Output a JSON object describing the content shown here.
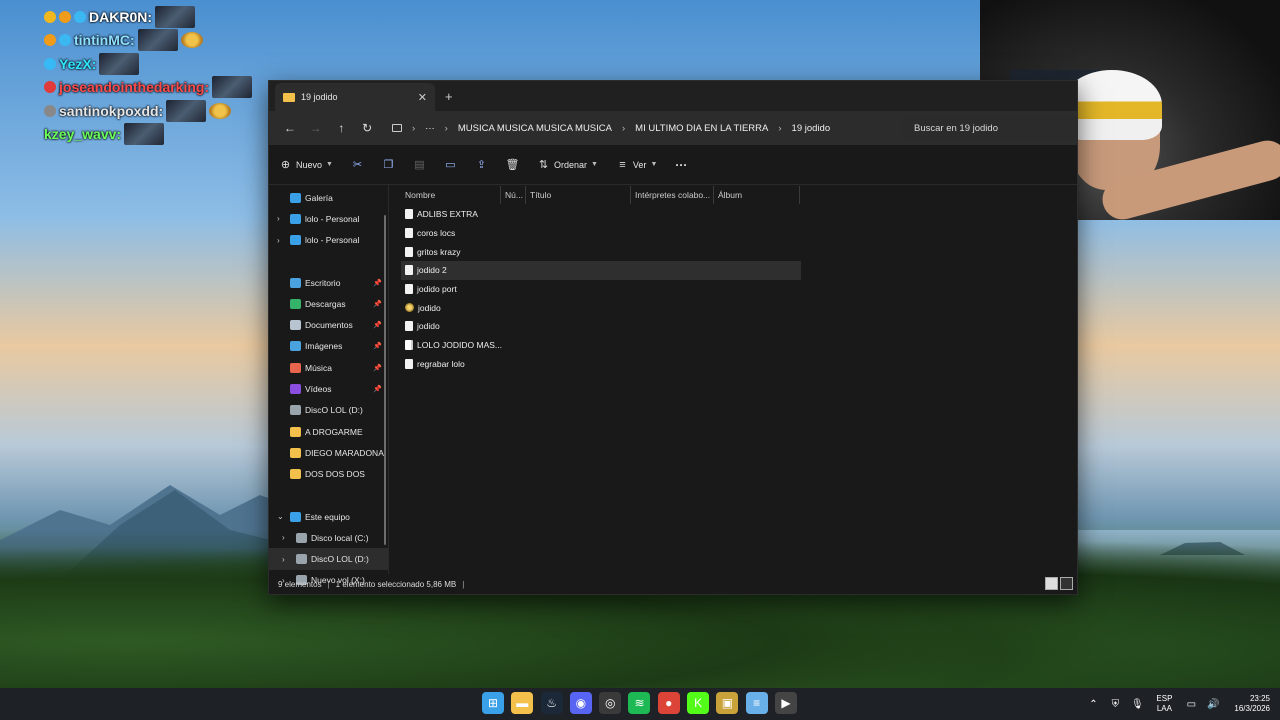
{
  "chat": [
    {
      "name": "DAKR0N:",
      "color": "#ffffff",
      "badges": [
        "#f3b81d",
        "#f09c1a",
        "#3bb7f2"
      ],
      "emote_color": "#2a3446",
      "extra_emote": false
    },
    {
      "name": "tintinMC:",
      "color": "#8fe0ff",
      "badges": [
        "#f09c1a",
        "#3bb7f2"
      ],
      "extra_emote": true
    },
    {
      "name": "YezX:",
      "color": "#2ee7ff",
      "badges": [
        "#36b9f4"
      ],
      "extra_emote": false
    },
    {
      "name": "joseandointhedarking:",
      "color": "#ff4b4b",
      "badges": [
        "#e03a3a"
      ],
      "extra_emote": false
    },
    {
      "name": "santinokpoxdd:",
      "color": "#e6e6e6",
      "badges": [
        "#888888"
      ],
      "extra_emote": true
    },
    {
      "name": "kzey_wavv:",
      "color": "#6cff5c",
      "badges": [],
      "extra_emote": false
    }
  ],
  "explorer": {
    "tab_title": "19 jodido",
    "breadcrumb": [
      "MUSICA MUSICA MUSICA MUSICA",
      "MI ULTIMO DIA EN LA TIERRA",
      "19 jodido"
    ],
    "search_placeholder": "Buscar en 19 jodido",
    "toolbar": {
      "new_label": "Nuevo",
      "sort_label": "Ordenar",
      "view_label": "Ver",
      "more_label": "···"
    },
    "sidebar": [
      {
        "label": "Galería",
        "icon": "gallery-icon",
        "color": "#3aa0e8",
        "chevron": false,
        "pin": false
      },
      {
        "label": "lolo - Personal",
        "icon": "cloud-icon",
        "color": "#3aa0e8",
        "chevron": true,
        "pin": false
      },
      {
        "label": "lolo - Personal",
        "icon": "cloud-icon",
        "color": "#3aa0e8",
        "chevron": true,
        "pin": false
      },
      {
        "gap": true
      },
      {
        "label": "Escritorio",
        "icon": "desktop-icon",
        "color": "#4aa3df",
        "chevron": false,
        "pin": true
      },
      {
        "label": "Descargas",
        "icon": "download-icon",
        "color": "#36b36a",
        "chevron": false,
        "pin": true
      },
      {
        "label": "Documentos",
        "icon": "document-icon",
        "color": "#b9c4d1",
        "chevron": false,
        "pin": true
      },
      {
        "label": "Imágenes",
        "icon": "image-icon",
        "color": "#4aa3df",
        "chevron": false,
        "pin": true
      },
      {
        "label": "Música",
        "icon": "music-icon",
        "color": "#e8654d",
        "chevron": false,
        "pin": true
      },
      {
        "label": "Vídeos",
        "icon": "video-icon",
        "color": "#8a4fe0",
        "chevron": false,
        "pin": true
      },
      {
        "label": "DiscO LOL (D:)",
        "icon": "drive-icon",
        "color": "#9aa4ad",
        "chevron": false,
        "pin": false
      },
      {
        "label": "A DROGARME",
        "icon": "folder-icon",
        "color": "#f3c14b",
        "chevron": false,
        "pin": false
      },
      {
        "label": "DIEGO MARADONA",
        "icon": "folder-icon",
        "color": "#f3c14b",
        "chevron": false,
        "pin": false
      },
      {
        "label": "DOS DOS DOS",
        "icon": "folder-icon",
        "color": "#f3c14b",
        "chevron": false,
        "pin": false
      },
      {
        "gap": true
      },
      {
        "label": "Este equipo",
        "icon": "computer-icon",
        "color": "#3aa0e8",
        "chevron": "open",
        "pin": false
      },
      {
        "label": "Disco local (C:)",
        "icon": "drive-icon",
        "color": "#9aa4ad",
        "chevron": true,
        "pin": false,
        "indent": true
      },
      {
        "label": "DiscO LOL (D:)",
        "icon": "drive-icon",
        "color": "#9aa4ad",
        "chevron": true,
        "pin": false,
        "indent": true,
        "selected": true
      },
      {
        "label": "Nuevo vol (X:)",
        "icon": "drive-icon",
        "color": "#9aa4ad",
        "chevron": true,
        "pin": false,
        "indent": true
      }
    ],
    "columns": [
      "Nombre",
      "Nú...",
      "Título",
      "Intérpretes colabo...",
      "Álbum"
    ],
    "files": [
      {
        "name": "ADLIBS EXTRA",
        "icon": "audio-file-icon",
        "selected": false
      },
      {
        "name": "coros locs",
        "icon": "audio-file-icon",
        "selected": false
      },
      {
        "name": "gritos krazy",
        "icon": "audio-file-icon",
        "selected": false
      },
      {
        "name": "jodido 2",
        "icon": "audio-file-icon",
        "selected": true
      },
      {
        "name": "jodido port",
        "icon": "audio-file-icon",
        "selected": false
      },
      {
        "name": "jodido",
        "icon": "project-file-icon",
        "selected": false
      },
      {
        "name": "jodido",
        "icon": "audio-file-icon",
        "selected": false
      },
      {
        "name": "LOLO JODIDO MAS...",
        "icon": "document-file-icon",
        "selected": false
      },
      {
        "name": "regrabar lolo",
        "icon": "audio-file-icon",
        "selected": false
      }
    ],
    "status": {
      "count": "9 elementos",
      "selection": "1 elemento seleccionado  5,86 MB"
    }
  },
  "taskbar": {
    "apps": [
      {
        "name": "start-icon",
        "color": "#3aa0e8",
        "glyph": "⊞"
      },
      {
        "name": "file-explorer-icon",
        "color": "#f3c14b",
        "glyph": "▬"
      },
      {
        "name": "steam-icon",
        "color": "#1b2838",
        "glyph": "♨"
      },
      {
        "name": "discord-icon",
        "color": "#5865f2",
        "glyph": "◉"
      },
      {
        "name": "obs-icon",
        "color": "#3a3a3a",
        "glyph": "◎"
      },
      {
        "name": "spotify-icon",
        "color": "#1db954",
        "glyph": "≋"
      },
      {
        "name": "chrome-icon",
        "color": "#db4437",
        "glyph": "●"
      },
      {
        "name": "kick-icon",
        "color": "#53fc18",
        "glyph": "K"
      },
      {
        "name": "app-icon",
        "color": "#c9a23a",
        "glyph": "▣"
      },
      {
        "name": "notepad-icon",
        "color": "#6ab0e8",
        "glyph": "≡"
      },
      {
        "name": "media-player-icon",
        "color": "#444",
        "glyph": "▶"
      }
    ],
    "language": [
      "ESP",
      "LAA"
    ],
    "time": "23:25",
    "date": "16/3/2026"
  }
}
